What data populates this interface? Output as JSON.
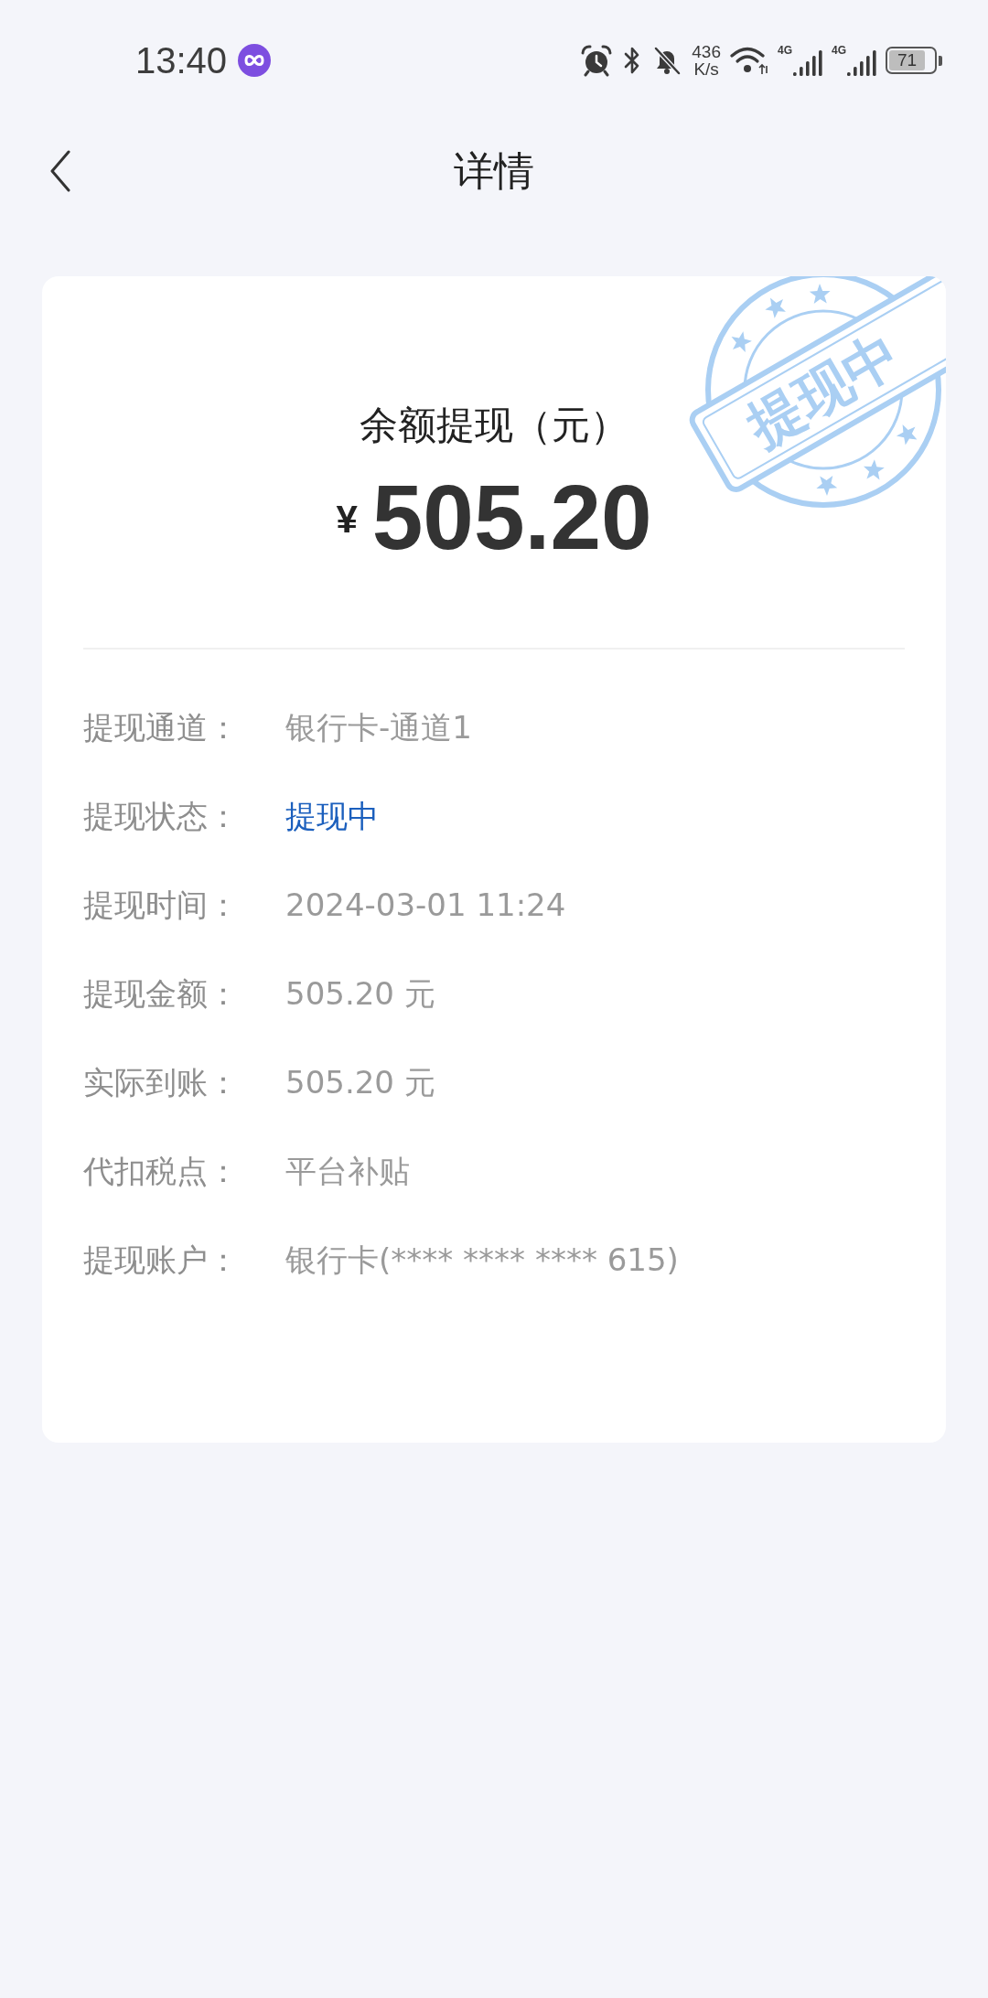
{
  "status_bar": {
    "time": "13:40",
    "net_speed": "436",
    "net_speed_unit": "K/s",
    "signals": [
      {
        "network": "4G"
      },
      {
        "network": "4G"
      }
    ],
    "battery": "71"
  },
  "header": {
    "title": "详情"
  },
  "card": {
    "stamp": "提现中",
    "title": "余额提现（元）",
    "currency": "¥",
    "amount": "505.20",
    "rows": [
      {
        "kind": "plain",
        "label": "提现通道：",
        "value": "银行卡-通道1"
      },
      {
        "kind": "status",
        "label": "提现状态：",
        "value": "提现中"
      },
      {
        "kind": "plain",
        "label": "提现时间：",
        "value": "2024-03-01 11:24"
      },
      {
        "kind": "plain",
        "label": "提现金额：",
        "value": "505.20 元"
      },
      {
        "kind": "plain",
        "label": "实际到账：",
        "value": "505.20 元"
      },
      {
        "kind": "plain",
        "label": "代扣税点：",
        "value": "平台补贴"
      },
      {
        "kind": "plain",
        "label": "提现账户：",
        "value": "银行卡(**** **** **** 615)"
      }
    ]
  }
}
